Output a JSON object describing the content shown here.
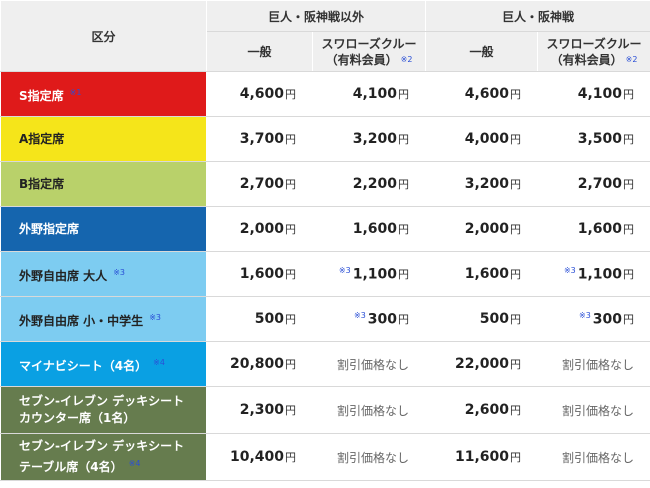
{
  "header": {
    "kubun": "区分",
    "group1": "巨人・阪神戦以外",
    "group2": "巨人・阪神戦",
    "general": "一般",
    "crew_line1": "スワローズクルー",
    "crew_line2": "（有料会員）",
    "crew_note": "※2"
  },
  "yen": "円",
  "rows": [
    {
      "label": "S指定席",
      "label2": "",
      "note": "※1",
      "bg": "#df1a1a",
      "text_color": "#ffffff",
      "p1": "4,600",
      "p1_note": "",
      "p2": "4,100",
      "p2_note": "",
      "p3": "4,600",
      "p3_note": "",
      "p4": "4,100",
      "p4_note": ""
    },
    {
      "label": "A指定席",
      "label2": "",
      "note": "",
      "bg": "#f5e51a",
      "text_color": "#222222",
      "p1": "3,700",
      "p1_note": "",
      "p2": "3,200",
      "p2_note": "",
      "p3": "4,000",
      "p3_note": "",
      "p4": "3,500",
      "p4_note": ""
    },
    {
      "label": "B指定席",
      "label2": "",
      "note": "",
      "bg": "#b9d16a",
      "text_color": "#222222",
      "p1": "2,700",
      "p1_note": "",
      "p2": "2,200",
      "p2_note": "",
      "p3": "3,200",
      "p3_note": "",
      "p4": "2,700",
      "p4_note": ""
    },
    {
      "label": "外野指定席",
      "label2": "",
      "note": "",
      "bg": "#1565ae",
      "text_color": "#ffffff",
      "p1": "2,000",
      "p1_note": "",
      "p2": "1,600",
      "p2_note": "",
      "p3": "2,000",
      "p3_note": "",
      "p4": "1,600",
      "p4_note": ""
    },
    {
      "label": "外野自由席 大人",
      "label2": "",
      "note": "※3",
      "bg": "#7dccf1",
      "text_color": "#222222",
      "p1": "1,600",
      "p1_note": "",
      "p2": "1,100",
      "p2_note": "※3",
      "p3": "1,600",
      "p3_note": "",
      "p4": "1,100",
      "p4_note": "※3"
    },
    {
      "label": "外野自由席 小・中学生",
      "label2": "",
      "note": "※3",
      "bg": "#7dccf1",
      "text_color": "#222222",
      "p1": "500",
      "p1_note": "",
      "p2": "300",
      "p2_note": "※3",
      "p3": "500",
      "p3_note": "",
      "p4": "300",
      "p4_note": "※3"
    },
    {
      "label": "マイナビシート（4名）",
      "label2": "",
      "note": "※4",
      "bg": "#0aa0e3",
      "text_color": "#ffffff",
      "p1": "20,800",
      "p1_note": "",
      "p2_none": "割引価格なし",
      "p3": "22,000",
      "p3_note": "",
      "p4_none": "割引価格なし"
    },
    {
      "label": "セブン-イレブン デッキシート",
      "label2": "カウンター席（1名）",
      "note": "",
      "bg": "#667c4e",
      "text_color": "#ffffff",
      "p1": "2,300",
      "p1_note": "",
      "p2_none": "割引価格なし",
      "p3": "2,600",
      "p3_note": "",
      "p4_none": "割引価格なし"
    },
    {
      "label": "セブン-イレブン デッキシート",
      "label2": "テーブル席（4名）",
      "note": "※4",
      "bg": "#667c4e",
      "text_color": "#ffffff",
      "p1": "10,400",
      "p1_note": "",
      "p2_none": "割引価格なし",
      "p3": "11,600",
      "p3_note": "",
      "p4_none": "割引価格なし"
    }
  ]
}
